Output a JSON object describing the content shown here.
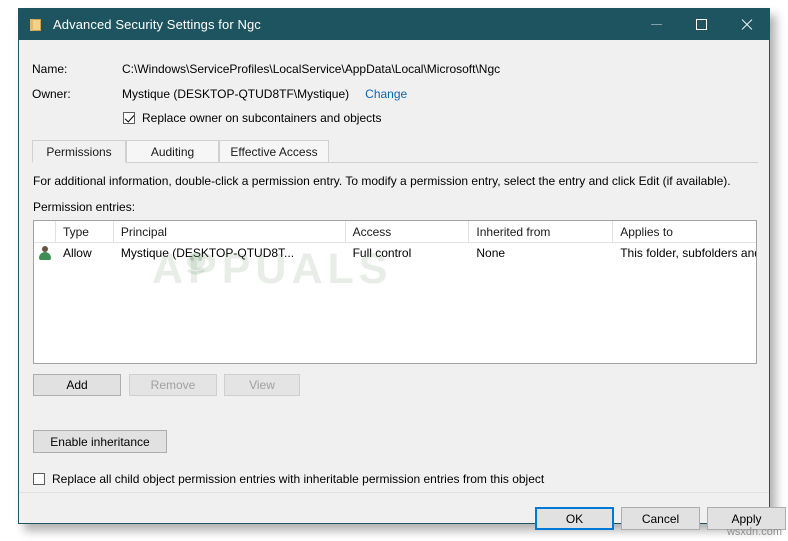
{
  "window": {
    "title": "Advanced Security Settings for Ngc",
    "icon": "folder-icon",
    "accent_color": "#1d5460",
    "caption": {
      "minimize": "minimize-icon",
      "maximize": "maximize-icon",
      "close": "close-icon"
    }
  },
  "header": {
    "name_label": "Name:",
    "name_value": "C:\\Windows\\ServiceProfiles\\LocalService\\AppData\\Local\\Microsoft\\Ngc",
    "owner_label": "Owner:",
    "owner_value": "Mystique (DESKTOP-QTUD8TF\\Mystique)",
    "change_link": "Change",
    "replace_owner_checkbox": {
      "label": "Replace owner on subcontainers and objects",
      "checked": true
    }
  },
  "tabs": [
    {
      "label": "Permissions",
      "active": true
    },
    {
      "label": "Auditing",
      "active": false
    },
    {
      "label": "Effective Access",
      "active": false
    }
  ],
  "main": {
    "info_text": "For additional information, double-click a permission entry. To modify a permission entry, select the entry and click Edit (if available).",
    "entries_label": "Permission entries:",
    "table": {
      "columns": [
        "",
        "Type",
        "Principal",
        "Access",
        "Inherited from",
        "Applies to"
      ],
      "rows": [
        {
          "icon": "user-icon",
          "type": "Allow",
          "principal": "Mystique (DESKTOP-QTUD8T...",
          "access": "Full control",
          "inherited_from": "None",
          "applies_to": "This folder, subfolders and files"
        }
      ]
    },
    "watermark": "APPUALS"
  },
  "actions": {
    "add": {
      "label": "Add",
      "enabled": true
    },
    "remove": {
      "label": "Remove",
      "enabled": false
    },
    "view": {
      "label": "View",
      "enabled": false
    },
    "enable_inheritance": {
      "label": "Enable inheritance",
      "enabled": true
    },
    "replace_child_checkbox": {
      "label": "Replace all child object permission entries with inheritable permission entries from this object",
      "checked": false
    }
  },
  "footer": {
    "ok": "OK",
    "cancel": "Cancel",
    "apply": "Apply",
    "focus_color": "#0078d7"
  },
  "page_watermark": "wsxdn.com"
}
